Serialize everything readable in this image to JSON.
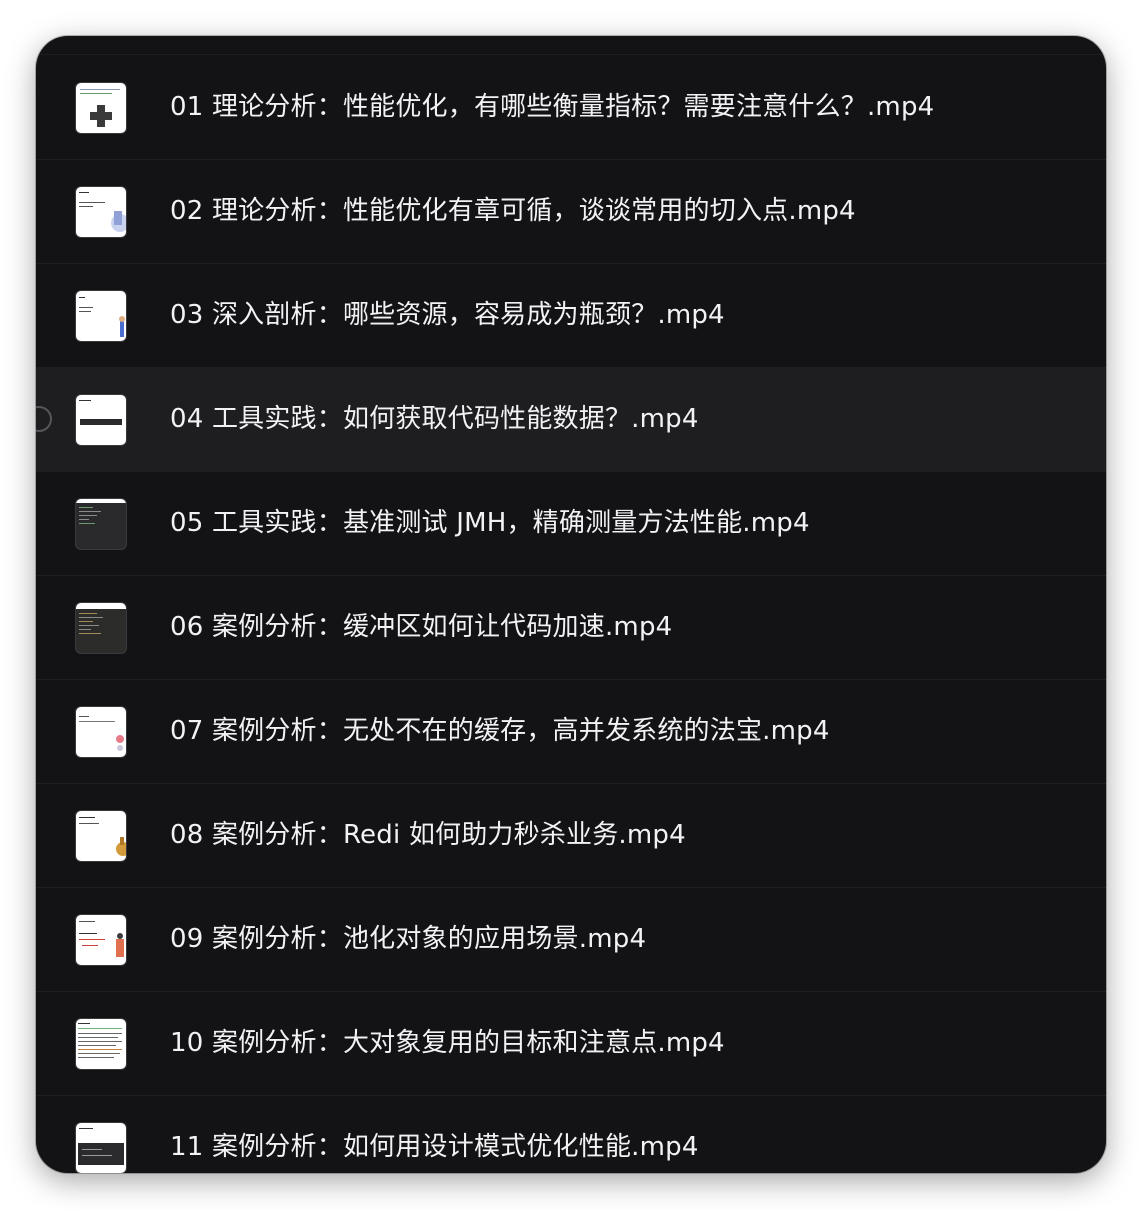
{
  "files": [
    {
      "title": "01 理论分析：性能优化，有哪些衡量指标？需要注意什么？.mp4",
      "thumb": "plus-icon"
    },
    {
      "title": "02 理论分析：性能优化有章可循，谈谈常用的切入点.mp4",
      "thumb": "slide-illustration"
    },
    {
      "title": "03 深入剖析：哪些资源，容易成为瓶颈？.mp4",
      "thumb": "slide-illustration"
    },
    {
      "title": "04 工具实践：如何获取代码性能数据？.mp4",
      "thumb": "slide-code-bar",
      "selected": true
    },
    {
      "title": "05 工具实践：基准测试 JMH，精确测量方法性能.mp4",
      "thumb": "code-editor"
    },
    {
      "title": "06 案例分析：缓冲区如何让代码加速.mp4",
      "thumb": "code-editor"
    },
    {
      "title": "07 案例分析：无处不在的缓存，高并发系统的法宝.mp4",
      "thumb": "slide-illustration"
    },
    {
      "title": "08 案例分析：Redi 如何助力秒杀业务.mp4",
      "thumb": "slide-illustration"
    },
    {
      "title": "09 案例分析：池化对象的应用场景.mp4",
      "thumb": "slide-illustration"
    },
    {
      "title": "10 案例分析：大对象复用的目标和注意点.mp4",
      "thumb": "slide-text"
    },
    {
      "title": "11 案例分析：如何用设计模式优化性能.mp4",
      "thumb": "slide-code-bar"
    }
  ]
}
